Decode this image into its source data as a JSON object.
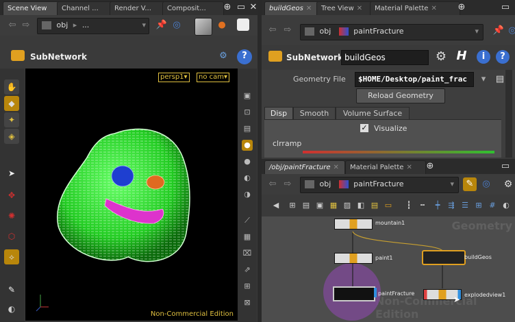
{
  "left_pane": {
    "tabs": [
      "Scene View",
      "Channel ...",
      "Render V...",
      "Composit..."
    ],
    "path": {
      "network": "obj",
      "child": "..."
    },
    "header": {
      "type_label": "SubNetwork"
    },
    "viewport": {
      "camera_menu": "persp1",
      "cam_menu": "no cam",
      "watermark": "Non-Commercial Edition"
    }
  },
  "right_top": {
    "tabs": [
      "buildGeos",
      "Tree View",
      "Material Palette"
    ],
    "path": {
      "network": "obj",
      "child": "paintFracture"
    },
    "header": {
      "type_label": "SubNetwork",
      "name": "buildGeos"
    },
    "params": {
      "geometry_file_label": "Geometry File",
      "geometry_file_value": "$HOME/Desktop/paint_frac",
      "reload_button": "Reload Geometry",
      "subtabs": [
        "Disp",
        "Smooth",
        "Volume Surface"
      ],
      "visualize_label": "Visualize",
      "visualize_checked": true,
      "clrramp_label": "clrramp"
    }
  },
  "right_bottom": {
    "tabs": [
      "/obj/paintFracture",
      "Material Palette"
    ],
    "path": {
      "network": "obj",
      "child": "paintFracture"
    },
    "network": {
      "context_watermark": "Geometry",
      "edition_watermark": "Non-Commercial Edition",
      "nodes": [
        {
          "name": "mountain1"
        },
        {
          "name": "paint1"
        },
        {
          "name": "buildGeos"
        },
        {
          "name": "paintFracture"
        },
        {
          "name": "explodedview1"
        }
      ]
    }
  },
  "colors": {
    "accent": "#e0a020",
    "selection": "#d7b030",
    "blue_button": "#3a6fd0",
    "tube_green": "#22dd22"
  }
}
